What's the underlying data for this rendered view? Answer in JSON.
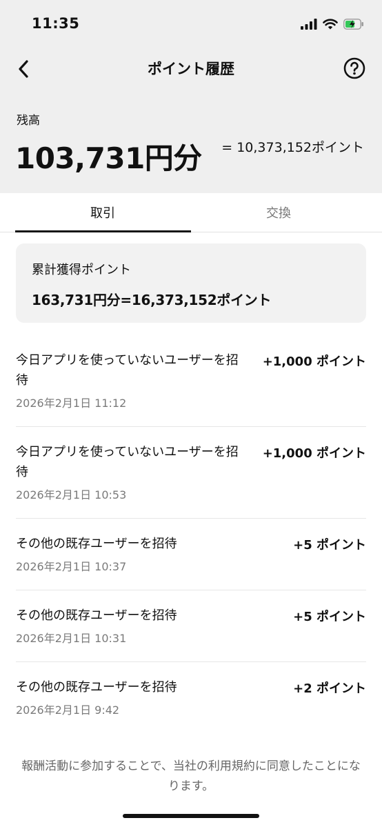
{
  "status_bar": {
    "time": "11:35",
    "icons": [
      "signal-icon",
      "wifi-icon",
      "battery-charging-icon"
    ],
    "battery_color": "#34c759"
  },
  "nav": {
    "title": "ポイント履歴",
    "back_icon": "chevron-left-icon",
    "help_icon": "question-circle-icon"
  },
  "balance": {
    "label": "残高",
    "amount": "103,731円分",
    "points": "= 10,373,152ポイント"
  },
  "tabs": [
    {
      "label": "取引",
      "active": true
    },
    {
      "label": "交換",
      "active": false
    }
  ],
  "summary": {
    "label": "累計獲得ポイント",
    "value": "163,731円分=16,373,152ポイント"
  },
  "history": [
    {
      "title": "今日アプリを使っていないユーザーを招待",
      "date": "2026年2月1日 11:12",
      "points": "+1,000 ポイント"
    },
    {
      "title": "今日アプリを使っていないユーザーを招待",
      "date": "2026年2月1日 10:53",
      "points": "+1,000 ポイント"
    },
    {
      "title": "その他の既存ユーザーを招待",
      "date": "2026年2月1日 10:37",
      "points": "+5 ポイント"
    },
    {
      "title": "その他の既存ユーザーを招待",
      "date": "2026年2月1日 10:31",
      "points": "+5 ポイント"
    },
    {
      "title": "その他の既存ユーザーを招待",
      "date": "2026年2月1日 9:42",
      "points": "+2 ポイント"
    }
  ],
  "footer": {
    "note": "報酬活動に参加することで、当社の利用規約に同意したことになります。"
  }
}
